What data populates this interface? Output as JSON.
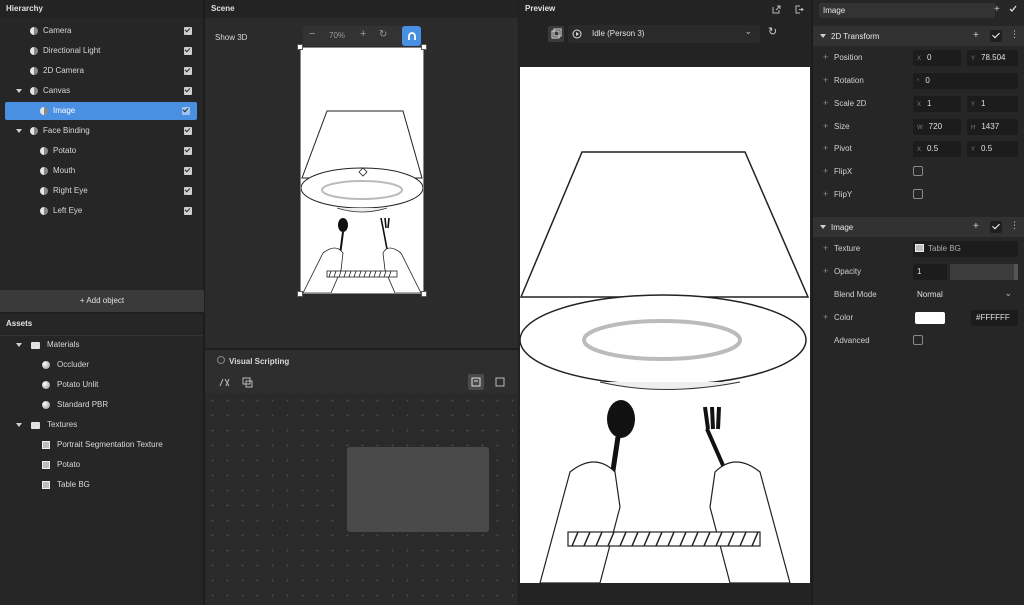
{
  "hierarchy": {
    "title": "Hierarchy",
    "items": [
      {
        "label": "Camera",
        "checked": true
      },
      {
        "label": "Directional Light",
        "checked": true
      },
      {
        "label": "2D Camera",
        "checked": true
      },
      {
        "label": "Canvas",
        "checked": true,
        "expanded": true
      },
      {
        "label": "Image",
        "checked": true,
        "selected": true
      },
      {
        "label": "Face Binding",
        "checked": true,
        "expanded": true
      },
      {
        "label": "Potato",
        "checked": true
      },
      {
        "label": "Mouth",
        "checked": true
      },
      {
        "label": "Right Eye",
        "checked": true
      },
      {
        "label": "Left Eye",
        "checked": true
      }
    ],
    "add_object_label": "+ Add object"
  },
  "assets": {
    "title": "Assets",
    "folders": [
      {
        "label": "Materials",
        "items": [
          "Occluder",
          "Potato Unlit",
          "Standard PBR"
        ]
      },
      {
        "label": "Textures",
        "items": [
          "Portrait Segmentation Texture",
          "Potato",
          "Table BG"
        ]
      }
    ]
  },
  "scene": {
    "title": "Scene",
    "show3d_label": "Show 3D",
    "zoom_level": "70%",
    "zoom_out_icon": "−",
    "zoom_in_icon": "+",
    "reset_icon": "↻"
  },
  "visual_scripting": {
    "title": "Visual Scripting"
  },
  "preview": {
    "title": "Preview",
    "animation": "Idle (Person 3)",
    "dropdown_icon": "⌄",
    "refresh_icon": "↻"
  },
  "inspector": {
    "object_name": "Image",
    "transform": {
      "title": "2D Transform",
      "position": {
        "label": "Position",
        "x": "0",
        "y": "78.504"
      },
      "rotation": {
        "label": "Rotation",
        "axis": "°",
        "value": "0"
      },
      "scale": {
        "label": "Scale 2D",
        "x": "1",
        "y": "1"
      },
      "size": {
        "label": "Size",
        "w": "720",
        "h": "1437"
      },
      "pivot": {
        "label": "Pivot",
        "x": "0.5",
        "y": "0.5"
      },
      "flipx": {
        "label": "FlipX",
        "checked": false
      },
      "flipy": {
        "label": "FlipY",
        "checked": false
      }
    },
    "image": {
      "title": "Image",
      "texture": {
        "label": "Texture",
        "value": "Table BG"
      },
      "opacity": {
        "label": "Opacity",
        "value": "1",
        "fraction": 1
      },
      "blend_mode": {
        "label": "Blend Mode",
        "value": "Normal"
      },
      "color": {
        "label": "Color",
        "hex": "#FFFFFF"
      },
      "advanced": {
        "label": "Advanced",
        "checked": false
      }
    },
    "axis_labels": {
      "x": "X",
      "y": "Y",
      "w": "W",
      "h": "H"
    }
  },
  "colors": {
    "accent": "#4a90e2",
    "panel": "#262626",
    "background": "#1e1e1e"
  }
}
